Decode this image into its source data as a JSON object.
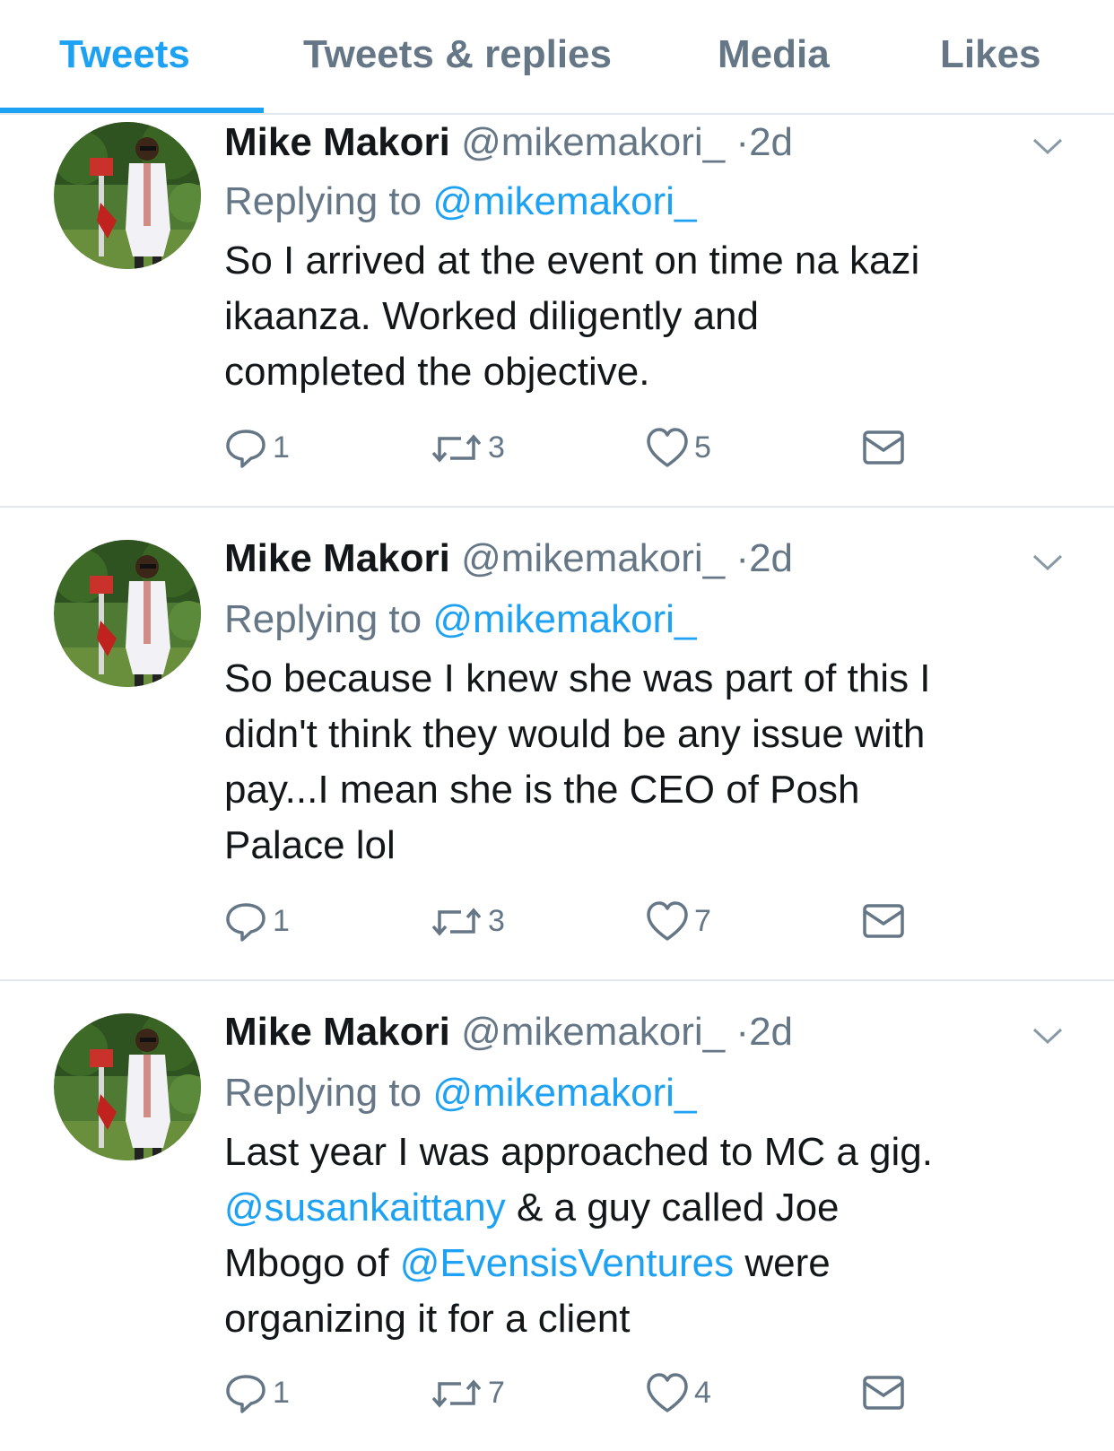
{
  "tabs": [
    {
      "label": "Tweets",
      "active": true
    },
    {
      "label": "Tweets & replies",
      "active": false
    },
    {
      "label": "Media",
      "active": false
    },
    {
      "label": "Likes",
      "active": false
    }
  ],
  "accent_color": "#1da1f2",
  "muted_color": "#657786",
  "tweets": [
    {
      "name": "Mike Makori",
      "handle": "@mikemakori_",
      "time": "2d",
      "replying_prefix": "Replying to",
      "replying_to": "@mikemakori_",
      "lines": [
        "So I arrived at the event on time na kazi",
        "ikaanza. Worked diligently and",
        "completed the objective."
      ],
      "replies": "1",
      "retweets": "3",
      "likes": "5"
    },
    {
      "name": "Mike Makori",
      "handle": "@mikemakori_",
      "time": "2d",
      "replying_prefix": "Replying to",
      "replying_to": "@mikemakori_",
      "lines": [
        "So because I knew she was part of this I",
        "didn't think they would be any issue with",
        "pay...I mean she is the CEO of Posh",
        "Palace lol"
      ],
      "replies": "1",
      "retweets": "3",
      "likes": "7"
    },
    {
      "name": "Mike Makori",
      "handle": "@mikemakori_",
      "time": "2d",
      "replying_prefix": "Replying to",
      "replying_to": "@mikemakori_",
      "text_line1": "Last year I was approached to MC a gig.",
      "mention1": "@susankaittany",
      "text_line2_rest": " & a guy called Joe",
      "text_line3_start": "Mbogo of ",
      "mention2": "@EvensisVentures",
      "text_line3_end": " were",
      "text_line4": "organizing it for a client",
      "replies": "1",
      "retweets": "7",
      "likes": "4"
    }
  ],
  "icons": {
    "reply": "reply-icon",
    "retweet": "retweet-icon",
    "like": "heart-icon",
    "dm": "envelope-icon",
    "caret": "chevron-down-icon"
  }
}
